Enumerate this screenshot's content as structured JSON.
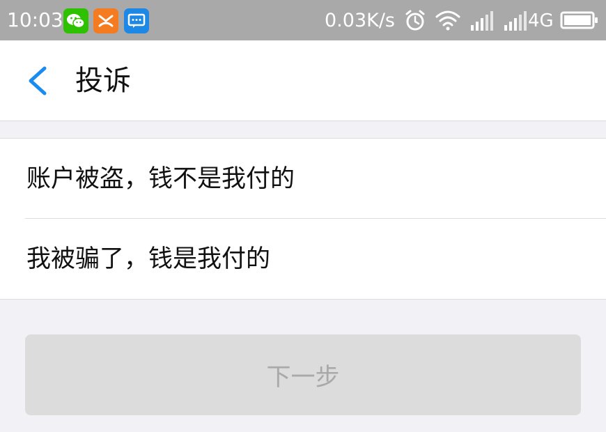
{
  "status_bar": {
    "time": "10:03",
    "network_speed": "0.03K/s",
    "network_type": "4G",
    "apps": [
      {
        "icon": "wechat-icon",
        "color": "#2dc100"
      },
      {
        "icon": "game-app-icon",
        "color": "#f47b20"
      },
      {
        "icon": "message-app-icon",
        "color": "#1e88e5"
      }
    ]
  },
  "navbar": {
    "title": "投诉",
    "back_icon": "chevron-left-icon",
    "accent_color": "#1a8cf0"
  },
  "options": [
    {
      "label": "账户被盗，钱不是我付的"
    },
    {
      "label": "我被骗了，钱是我付的"
    }
  ],
  "next_button": {
    "label": "下一步",
    "state": "disabled"
  }
}
